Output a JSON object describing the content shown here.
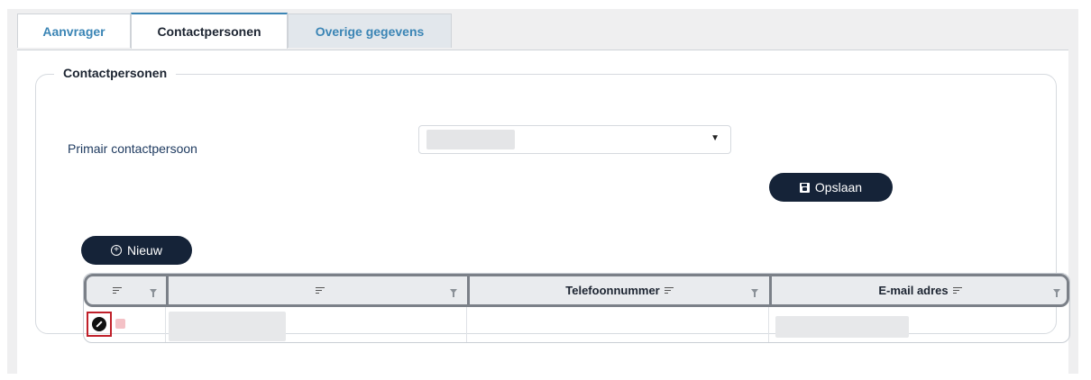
{
  "tabs": [
    {
      "label": "Aanvrager",
      "active": false
    },
    {
      "label": "Contactpersonen",
      "active": true
    },
    {
      "label": "Overige gegevens",
      "active": false
    }
  ],
  "group": {
    "legend": "Contactpersonen"
  },
  "form": {
    "primary_label": "Primair contactpersoon",
    "primary_value": ""
  },
  "buttons": {
    "save_label": "Opslaan",
    "new_label": "Nieuw"
  },
  "grid": {
    "columns": [
      {
        "label": ""
      },
      {
        "label": ""
      },
      {
        "label": "Telefoonnummer"
      },
      {
        "label": "E-mail adres"
      }
    ],
    "rows": [
      {
        "name": "",
        "phone": "",
        "email": ""
      }
    ]
  },
  "colors": {
    "accent": "#3b85b5",
    "button_bg": "#152338",
    "edit_highlight": "#c0202a"
  },
  "icons": [
    "caret-down-icon",
    "save-icon",
    "plus-circle-icon",
    "sort-icon",
    "filter-icon",
    "edit-icon",
    "delete-icon"
  ]
}
